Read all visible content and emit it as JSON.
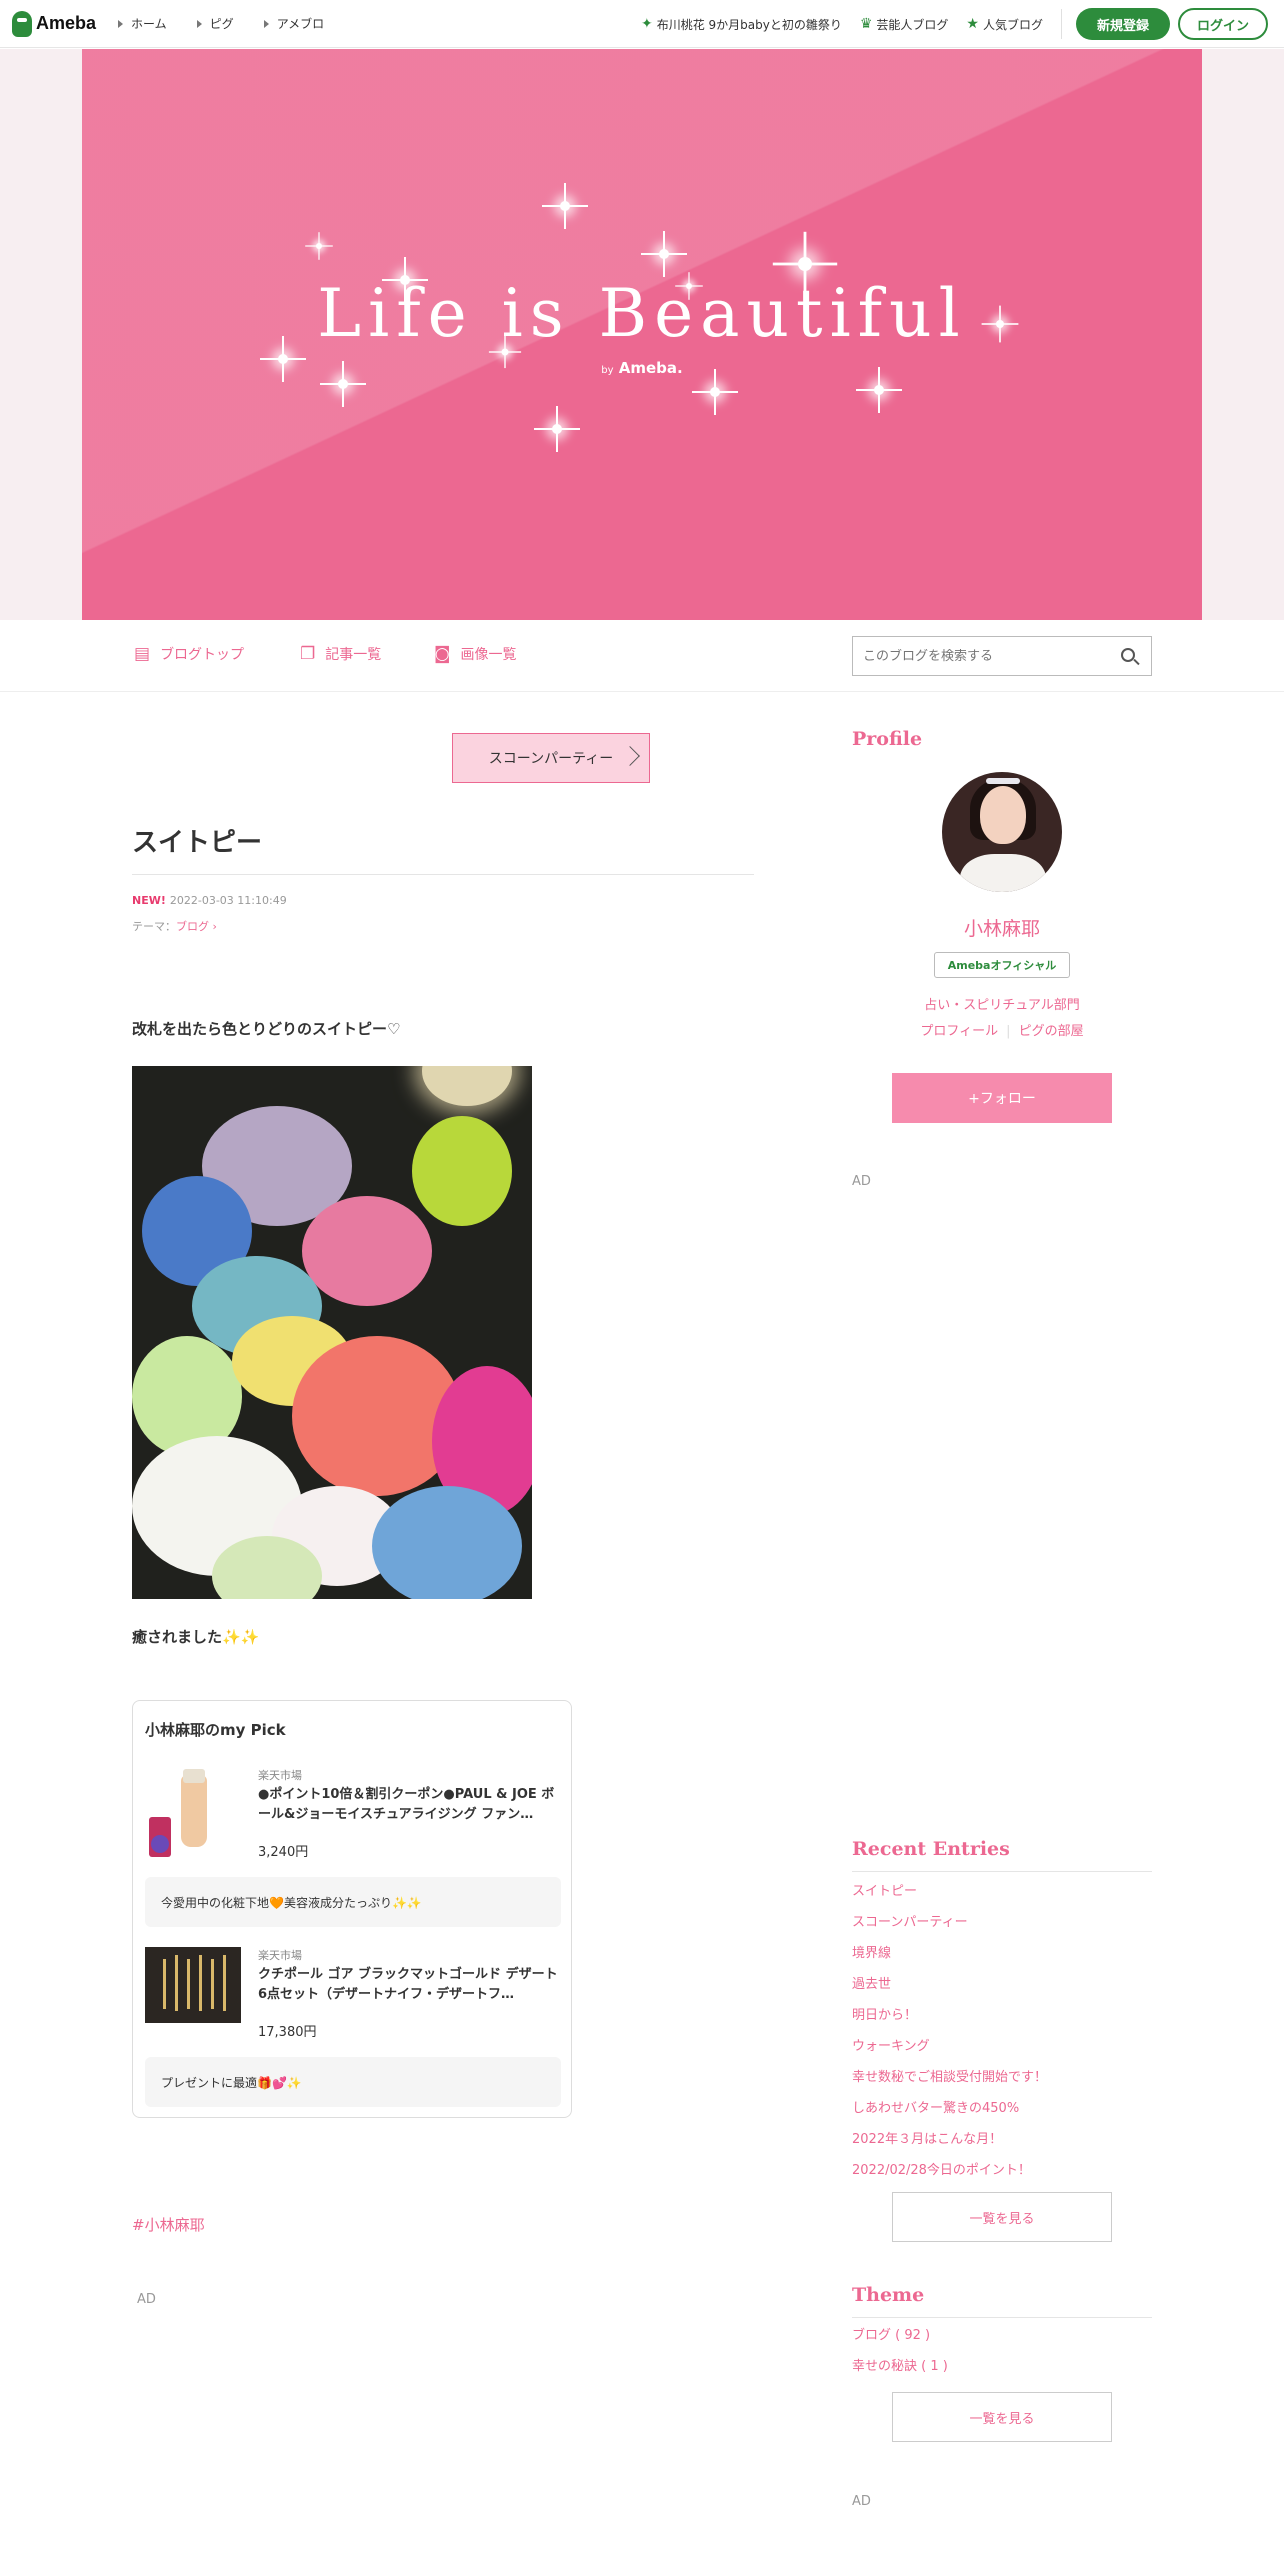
{
  "header": {
    "logo": "Ameba",
    "nav": [
      "ホーム",
      "ピグ",
      "アメブロ"
    ],
    "right_links": [
      {
        "icon": "sparkle-icon",
        "label": "布川桃花 9か月babyと初の雛祭り"
      },
      {
        "icon": "crown-icon",
        "label": "芸能人ブログ"
      },
      {
        "icon": "star-icon",
        "label": "人気ブログ"
      }
    ],
    "register": "新規登録",
    "login": "ログイン"
  },
  "banner": {
    "title": "Life is Beautiful",
    "by": "by",
    "brand": "Ameba."
  },
  "blognav": {
    "items": [
      {
        "icon": "document-icon",
        "label": "ブログトップ"
      },
      {
        "icon": "copy-icon",
        "label": "記事一覧"
      },
      {
        "icon": "camera-icon",
        "label": "画像一覧"
      }
    ],
    "search_placeholder": "このブログを検索する"
  },
  "article": {
    "prev_tag": "スコーンパーティー",
    "title": "スイトピー",
    "new_badge": "NEW!",
    "datetime": "2022-03-03 11:10:49",
    "theme_prefix": "テーマ：",
    "theme": "ブログ",
    "paragraph1": "改札を出たら色とりどりのスイトピー♡",
    "paragraph2": "癒されました✨✨",
    "pick": {
      "title": "小林麻耶のmy Pick",
      "products": [
        {
          "shop": "楽天市場",
          "name": "●ポイント10倍＆割引クーポン●PAUL & JOE ボール&ジョーモイスチュアライジング ファン…",
          "price": "3,240円",
          "comment": "今愛用中の化粧下地🧡美容液成分たっぷり✨✨"
        },
        {
          "shop": "楽天市場",
          "name": "クチポール ゴア ブラックマットゴールド デザート6点セット（デザートナイフ・デザートフ…",
          "price": "17,380円",
          "comment": "プレゼントに最適🎁💕✨"
        }
      ]
    },
    "hashtag": "#小林麻耶",
    "ad": "AD"
  },
  "sidebar": {
    "profile_heading": "Profile",
    "name": "小林麻耶",
    "official": "Amebaオフィシャル",
    "category": "占い・スピリチュアル部門",
    "link_profile": "プロフィール",
    "link_pig": "ピグの部屋",
    "follow": "+フォロー",
    "ad": "AD",
    "recent_heading": "Recent Entries",
    "recent": [
      "スイトピー",
      "スコーンパーティー",
      "境界線",
      "過去世",
      "明日から！",
      "ウォーキング",
      "幸せ数秘でご相談受付開始です！",
      "しあわせバター驚きの450%",
      "2022年３月はこんな月！",
      "2022/02/28今日のポイント！"
    ],
    "more": "一覧を見る",
    "theme_heading": "Theme",
    "themes": [
      "ブログ ( 92 )",
      "幸せの秘訣 ( 1 )"
    ],
    "more2": "一覧を見る",
    "ad2": "AD"
  }
}
